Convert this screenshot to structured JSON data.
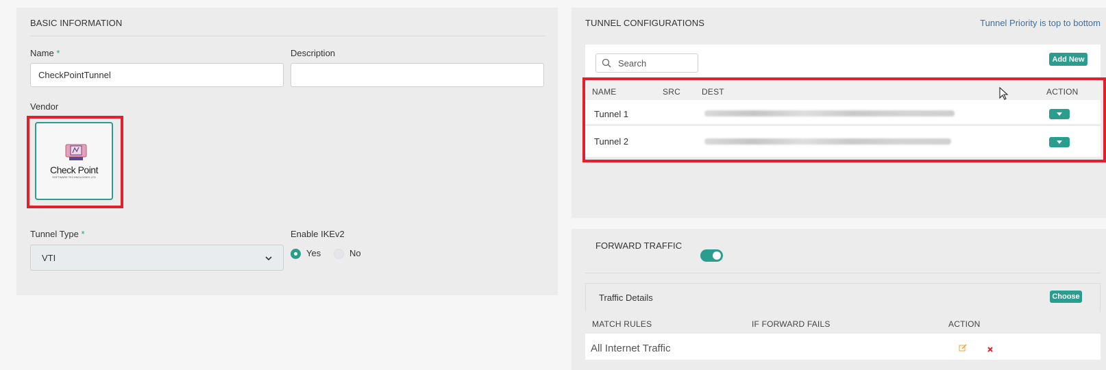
{
  "basic_info": {
    "title": "BASIC INFORMATION",
    "name_label": "Name",
    "required_mark": "*",
    "name_value": "CheckPointTunnel",
    "description_label": "Description",
    "description_value": "",
    "vendor_label": "Vendor",
    "vendor_name": "Check Point",
    "vendor_sub": "SOFTWARE TECHNOLOGIES LTD",
    "tunnel_type_label": "Tunnel Type",
    "tunnel_type_value": "VTI",
    "ikev2_label": "Enable IKEv2",
    "ikev2_yes": "Yes",
    "ikev2_no": "No",
    "ikev2_selected": "Yes"
  },
  "tunnel_config": {
    "title": "TUNNEL CONFIGURATIONS",
    "priority_note": "Tunnel Priority is top to bottom",
    "search_placeholder": "Search",
    "add_new_label": "Add New",
    "columns": [
      "NAME",
      "SRC",
      "DEST",
      "ACTION"
    ],
    "rows": [
      {
        "name": "Tunnel 1",
        "src": "",
        "dest": ""
      },
      {
        "name": "Tunnel 2",
        "src": "",
        "dest": ""
      }
    ]
  },
  "forward_traffic": {
    "title": "FORWARD TRAFFIC",
    "enabled": true,
    "details_title": "Traffic Details",
    "choose_label": "Choose",
    "columns": [
      "MATCH RULES",
      "IF FORWARD FAILS",
      "ACTION"
    ],
    "rows": [
      {
        "match_rule": "All Internet Traffic",
        "if_forward_fails": ""
      }
    ]
  },
  "colors": {
    "accent": "#2a9d8f",
    "highlight": "#e0202a",
    "link": "#3a6fa8",
    "edit_icon": "#f0a030",
    "delete_icon": "#e0202a"
  }
}
